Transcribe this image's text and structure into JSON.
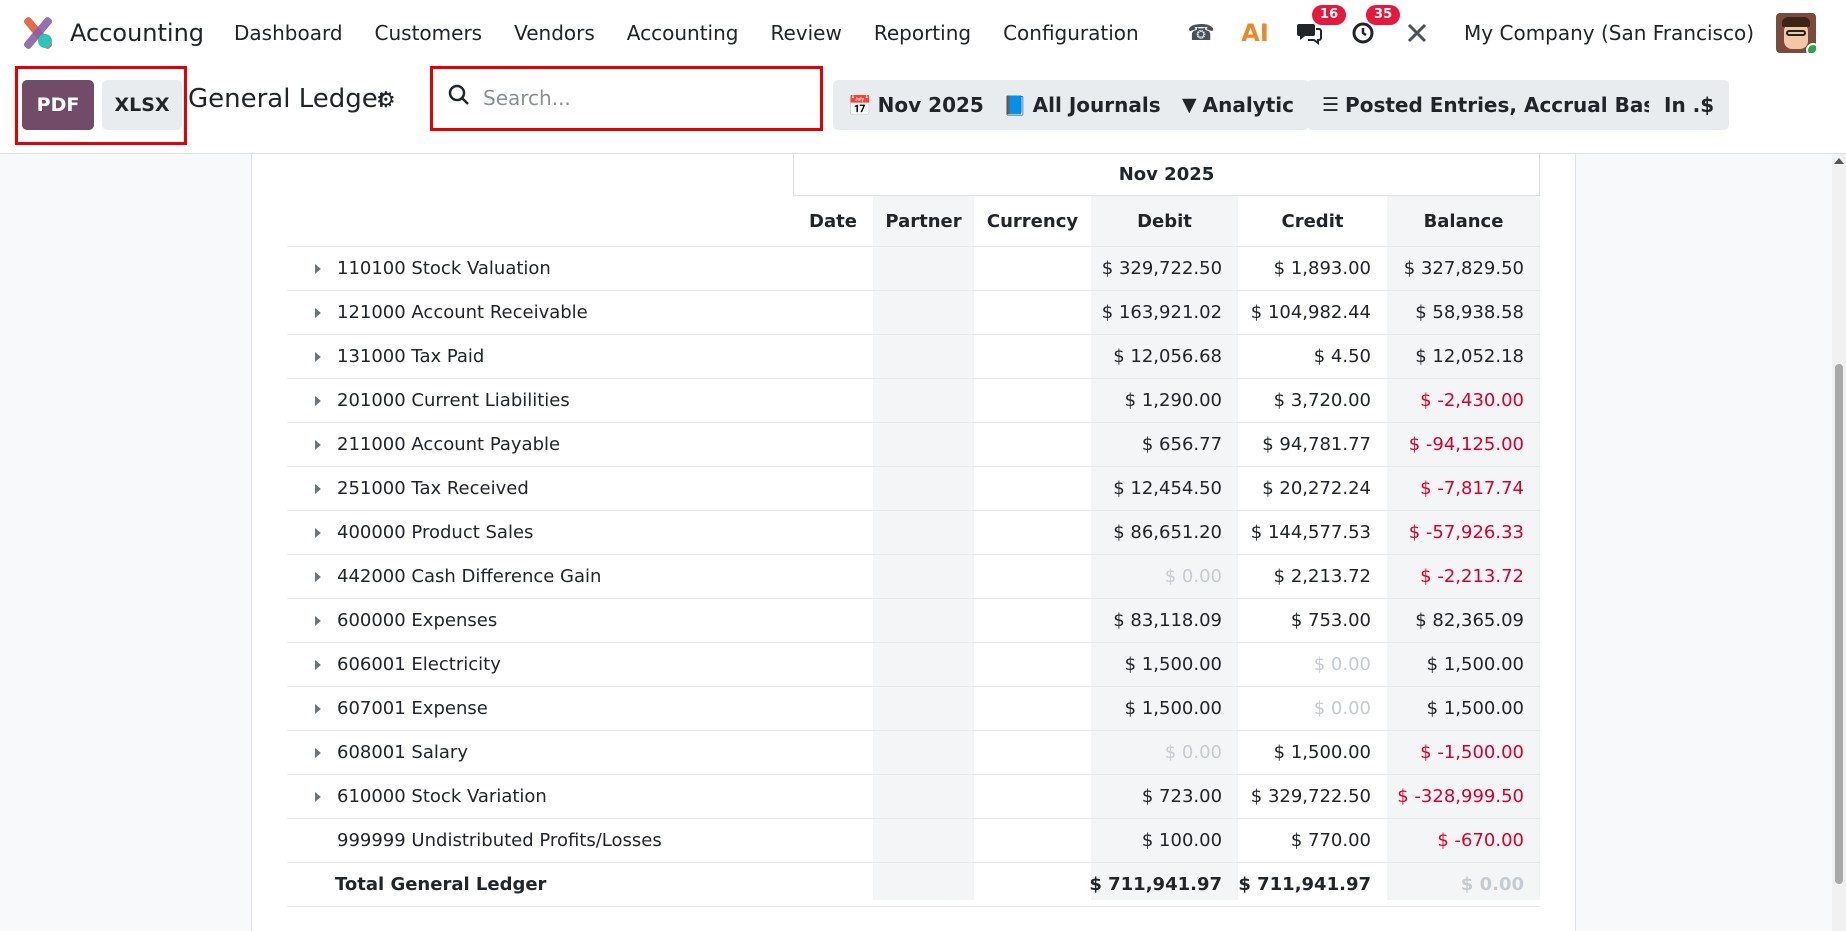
{
  "navbar": {
    "app_name": "Accounting",
    "menu": [
      "Dashboard",
      "Customers",
      "Vendors",
      "Accounting",
      "Review",
      "Reporting",
      "Configuration"
    ],
    "messages_badge": "16",
    "activities_badge": "35",
    "ai_label": "AI",
    "company": "My Company (San Francisco)"
  },
  "control": {
    "pdf_label": "PDF",
    "xlsx_label": "XLSX",
    "title": "General Ledger",
    "search_placeholder": "Search...",
    "filters": {
      "date": "Nov 2025",
      "journals": "All Journals",
      "analytic": "Analytic",
      "options": "Posted Entries, Accrual Basis",
      "currency": "In .$"
    }
  },
  "table": {
    "period": "Nov 2025",
    "columns": {
      "date": "Date",
      "partner": "Partner",
      "currency": "Currency",
      "debit": "Debit",
      "credit": "Credit",
      "balance": "Balance"
    },
    "rows": [
      {
        "name": "110100 Stock Valuation",
        "debit": "$ 329,722.50",
        "credit": "$ 1,893.00",
        "balance": "$ 327,829.50"
      },
      {
        "name": "121000 Account Receivable",
        "debit": "$ 163,921.02",
        "credit": "$ 104,982.44",
        "balance": "$ 58,938.58"
      },
      {
        "name": "131000 Tax Paid",
        "debit": "$ 12,056.68",
        "credit": "$ 4.50",
        "balance": "$ 12,052.18"
      },
      {
        "name": "201000 Current Liabilities",
        "debit": "$ 1,290.00",
        "credit": "$ 3,720.00",
        "balance": "$ -2,430.00"
      },
      {
        "name": "211000 Account Payable",
        "debit": "$ 656.77",
        "credit": "$ 94,781.77",
        "balance": "$ -94,125.00"
      },
      {
        "name": "251000 Tax Received",
        "debit": "$ 12,454.50",
        "credit": "$ 20,272.24",
        "balance": "$ -7,817.74"
      },
      {
        "name": "400000 Product Sales",
        "debit": "$ 86,651.20",
        "credit": "$ 144,577.53",
        "balance": "$ -57,926.33"
      },
      {
        "name": "442000 Cash Difference Gain",
        "debit": "$ 0.00",
        "credit": "$ 2,213.72",
        "balance": "$ -2,213.72"
      },
      {
        "name": "600000 Expenses",
        "debit": "$ 83,118.09",
        "credit": "$ 753.00",
        "balance": "$ 82,365.09"
      },
      {
        "name": "606001 Electricity",
        "debit": "$ 1,500.00",
        "credit": "$ 0.00",
        "balance": "$ 1,500.00"
      },
      {
        "name": "607001 Expense",
        "debit": "$ 1,500.00",
        "credit": "$ 0.00",
        "balance": "$ 1,500.00"
      },
      {
        "name": "608001 Salary",
        "debit": "$ 0.00",
        "credit": "$ 1,500.00",
        "balance": "$ -1,500.00"
      },
      {
        "name": "610000 Stock Variation",
        "debit": "$ 723.00",
        "credit": "$ 329,722.50",
        "balance": "$ -328,999.50"
      },
      {
        "name": "999999 Undistributed Profits/Losses",
        "debit": "$ 100.00",
        "credit": "$ 770.00",
        "balance": "$ -670.00"
      }
    ],
    "total": {
      "name": "Total General Ledger",
      "debit": "$ 711,941.97",
      "credit": "$ 711,941.97",
      "balance": "$ 0.00"
    }
  },
  "colors": {
    "brand": "#714b67",
    "negative": "#d6002b",
    "badge": "#e6193c",
    "highlight_box": "#e60000"
  }
}
